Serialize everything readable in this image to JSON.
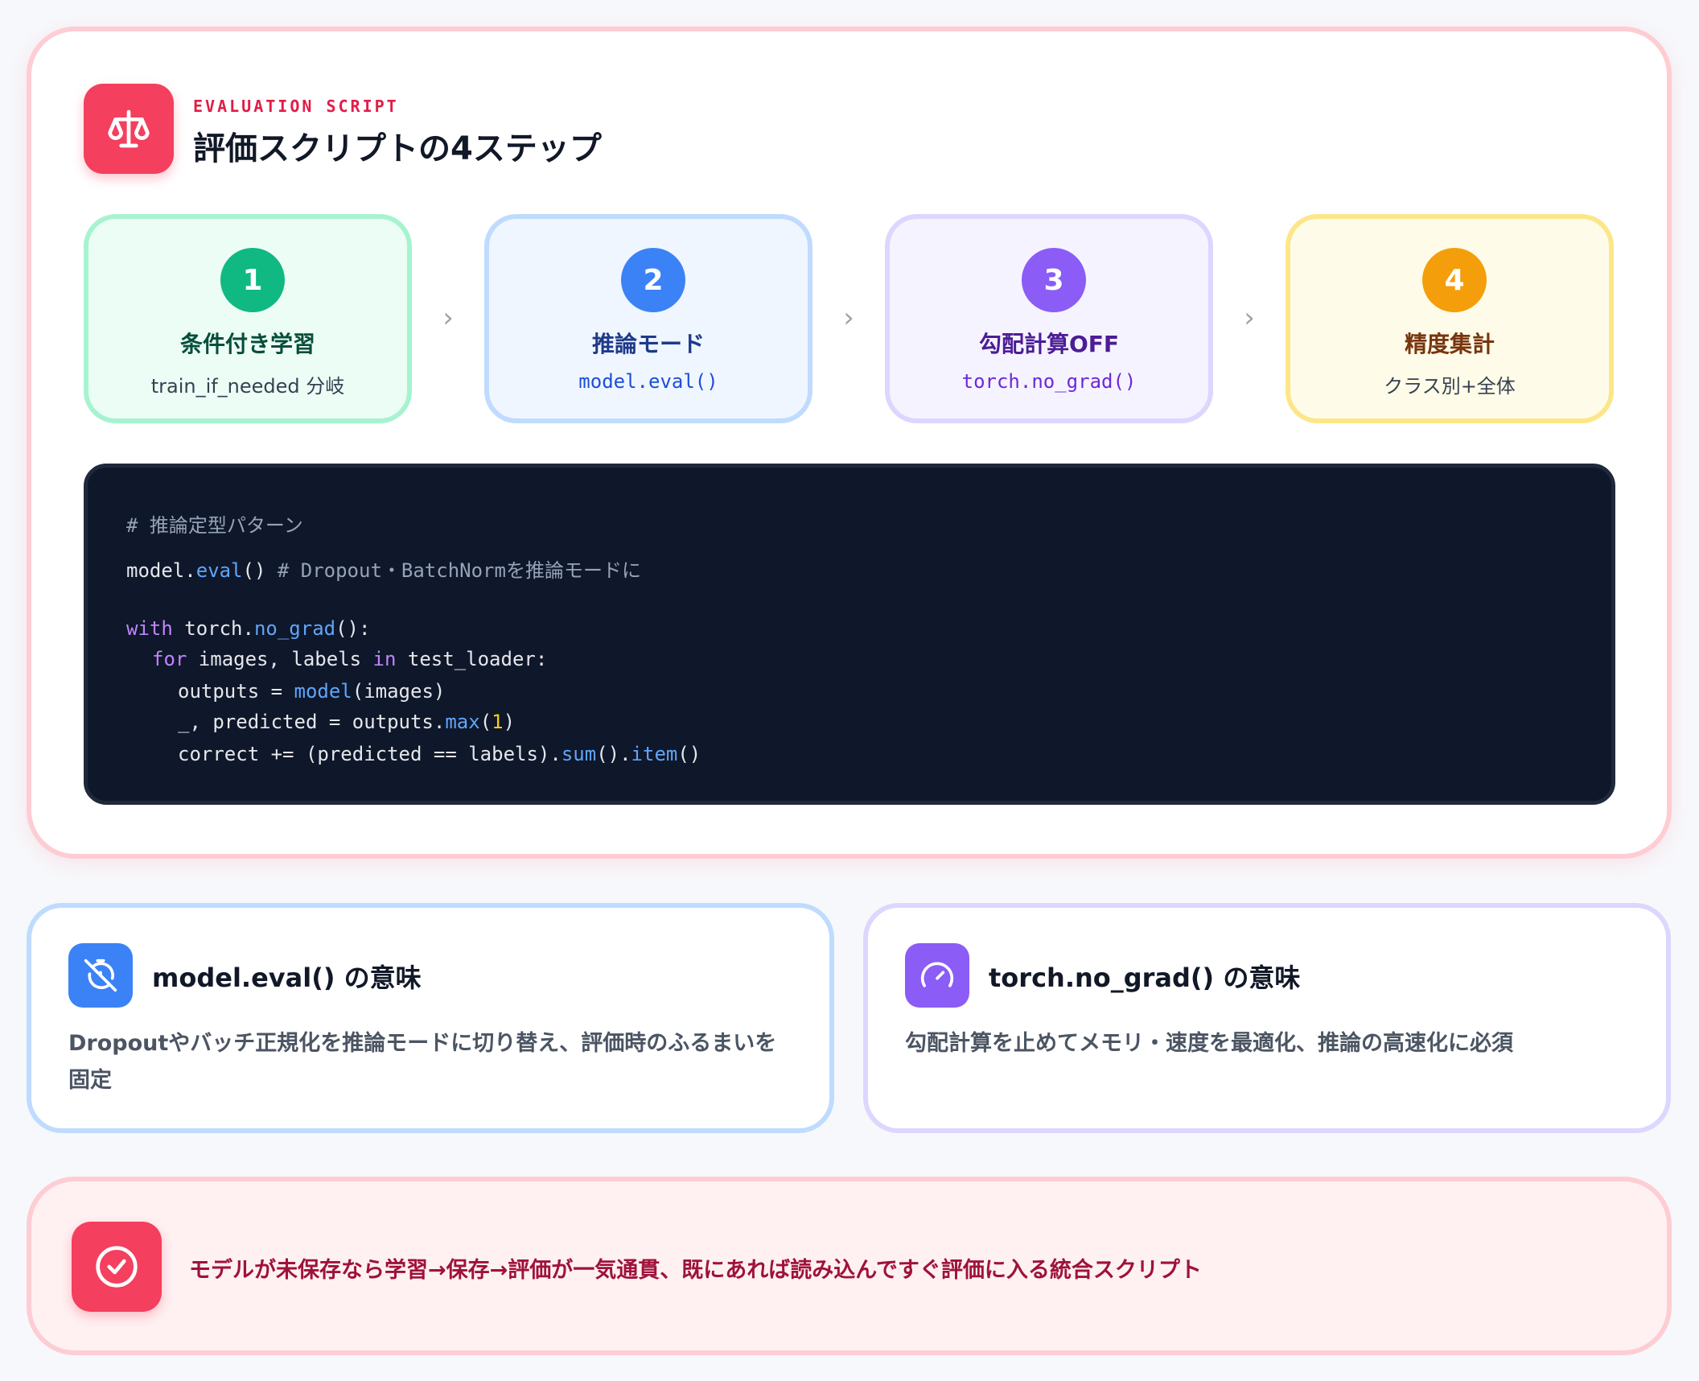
{
  "header": {
    "eyebrow": "EVALUATION SCRIPT",
    "title": "評価スクリプトの4ステップ",
    "icon": "scale-icon"
  },
  "steps": [
    {
      "number": "1",
      "title": "条件付き学習",
      "sub": "train_if_needed 分岐"
    },
    {
      "number": "2",
      "title": "推論モード",
      "sub": "model.eval()"
    },
    {
      "number": "3",
      "title": "勾配計算OFF",
      "sub": "torch.no_grad()"
    },
    {
      "number": "4",
      "title": "精度集計",
      "sub": "クラス別+全体"
    }
  ],
  "code": {
    "line1": "# 推論定型パターン",
    "line2_a": "model.",
    "line2_b": "eval",
    "line2_c": "() ",
    "line2_comment": "# Dropout・BatchNormを推論モードに",
    "line3_kw": "with",
    "line3_a": " torch.",
    "line3_fn": "no_grad",
    "line3_b": "():",
    "line4_kw": "for",
    "line4_a": " images, labels ",
    "line4_kw2": "in",
    "line4_b": " test_loader:",
    "line5_a": "outputs = ",
    "line5_fn": "model",
    "line5_b": "(images)",
    "line6_a": "_, predicted = outputs.",
    "line6_fn": "max",
    "line6_b": "(",
    "line6_num": "1",
    "line6_c": ")",
    "line7_a": "correct += (predicted == labels).",
    "line7_fn": "sum",
    "line7_b": "().",
    "line7_fn2": "item",
    "line7_c": "()"
  },
  "info": {
    "left": {
      "title": "model.eval() の意味",
      "desc": "Dropoutやバッチ正規化を推論モードに切り替え、評価時のふるまいを固定",
      "icon": "timer-off-icon"
    },
    "right": {
      "title": "torch.no_grad() の意味",
      "desc": "勾配計算を止めてメモリ・速度を最適化、推論の高速化に必須",
      "icon": "gauge-icon"
    }
  },
  "banner": {
    "text": "モデルが未保存なら学習→保存→評価が一気通貫、既にあれば読み込んですぐ評価に入る統合スクリプト",
    "icon": "check-circle-icon"
  },
  "colors": {
    "accent": "#f43f5e",
    "step1": "#10b981",
    "step2": "#3b82f6",
    "step3": "#8b5cf6",
    "step4": "#f59e0b"
  }
}
